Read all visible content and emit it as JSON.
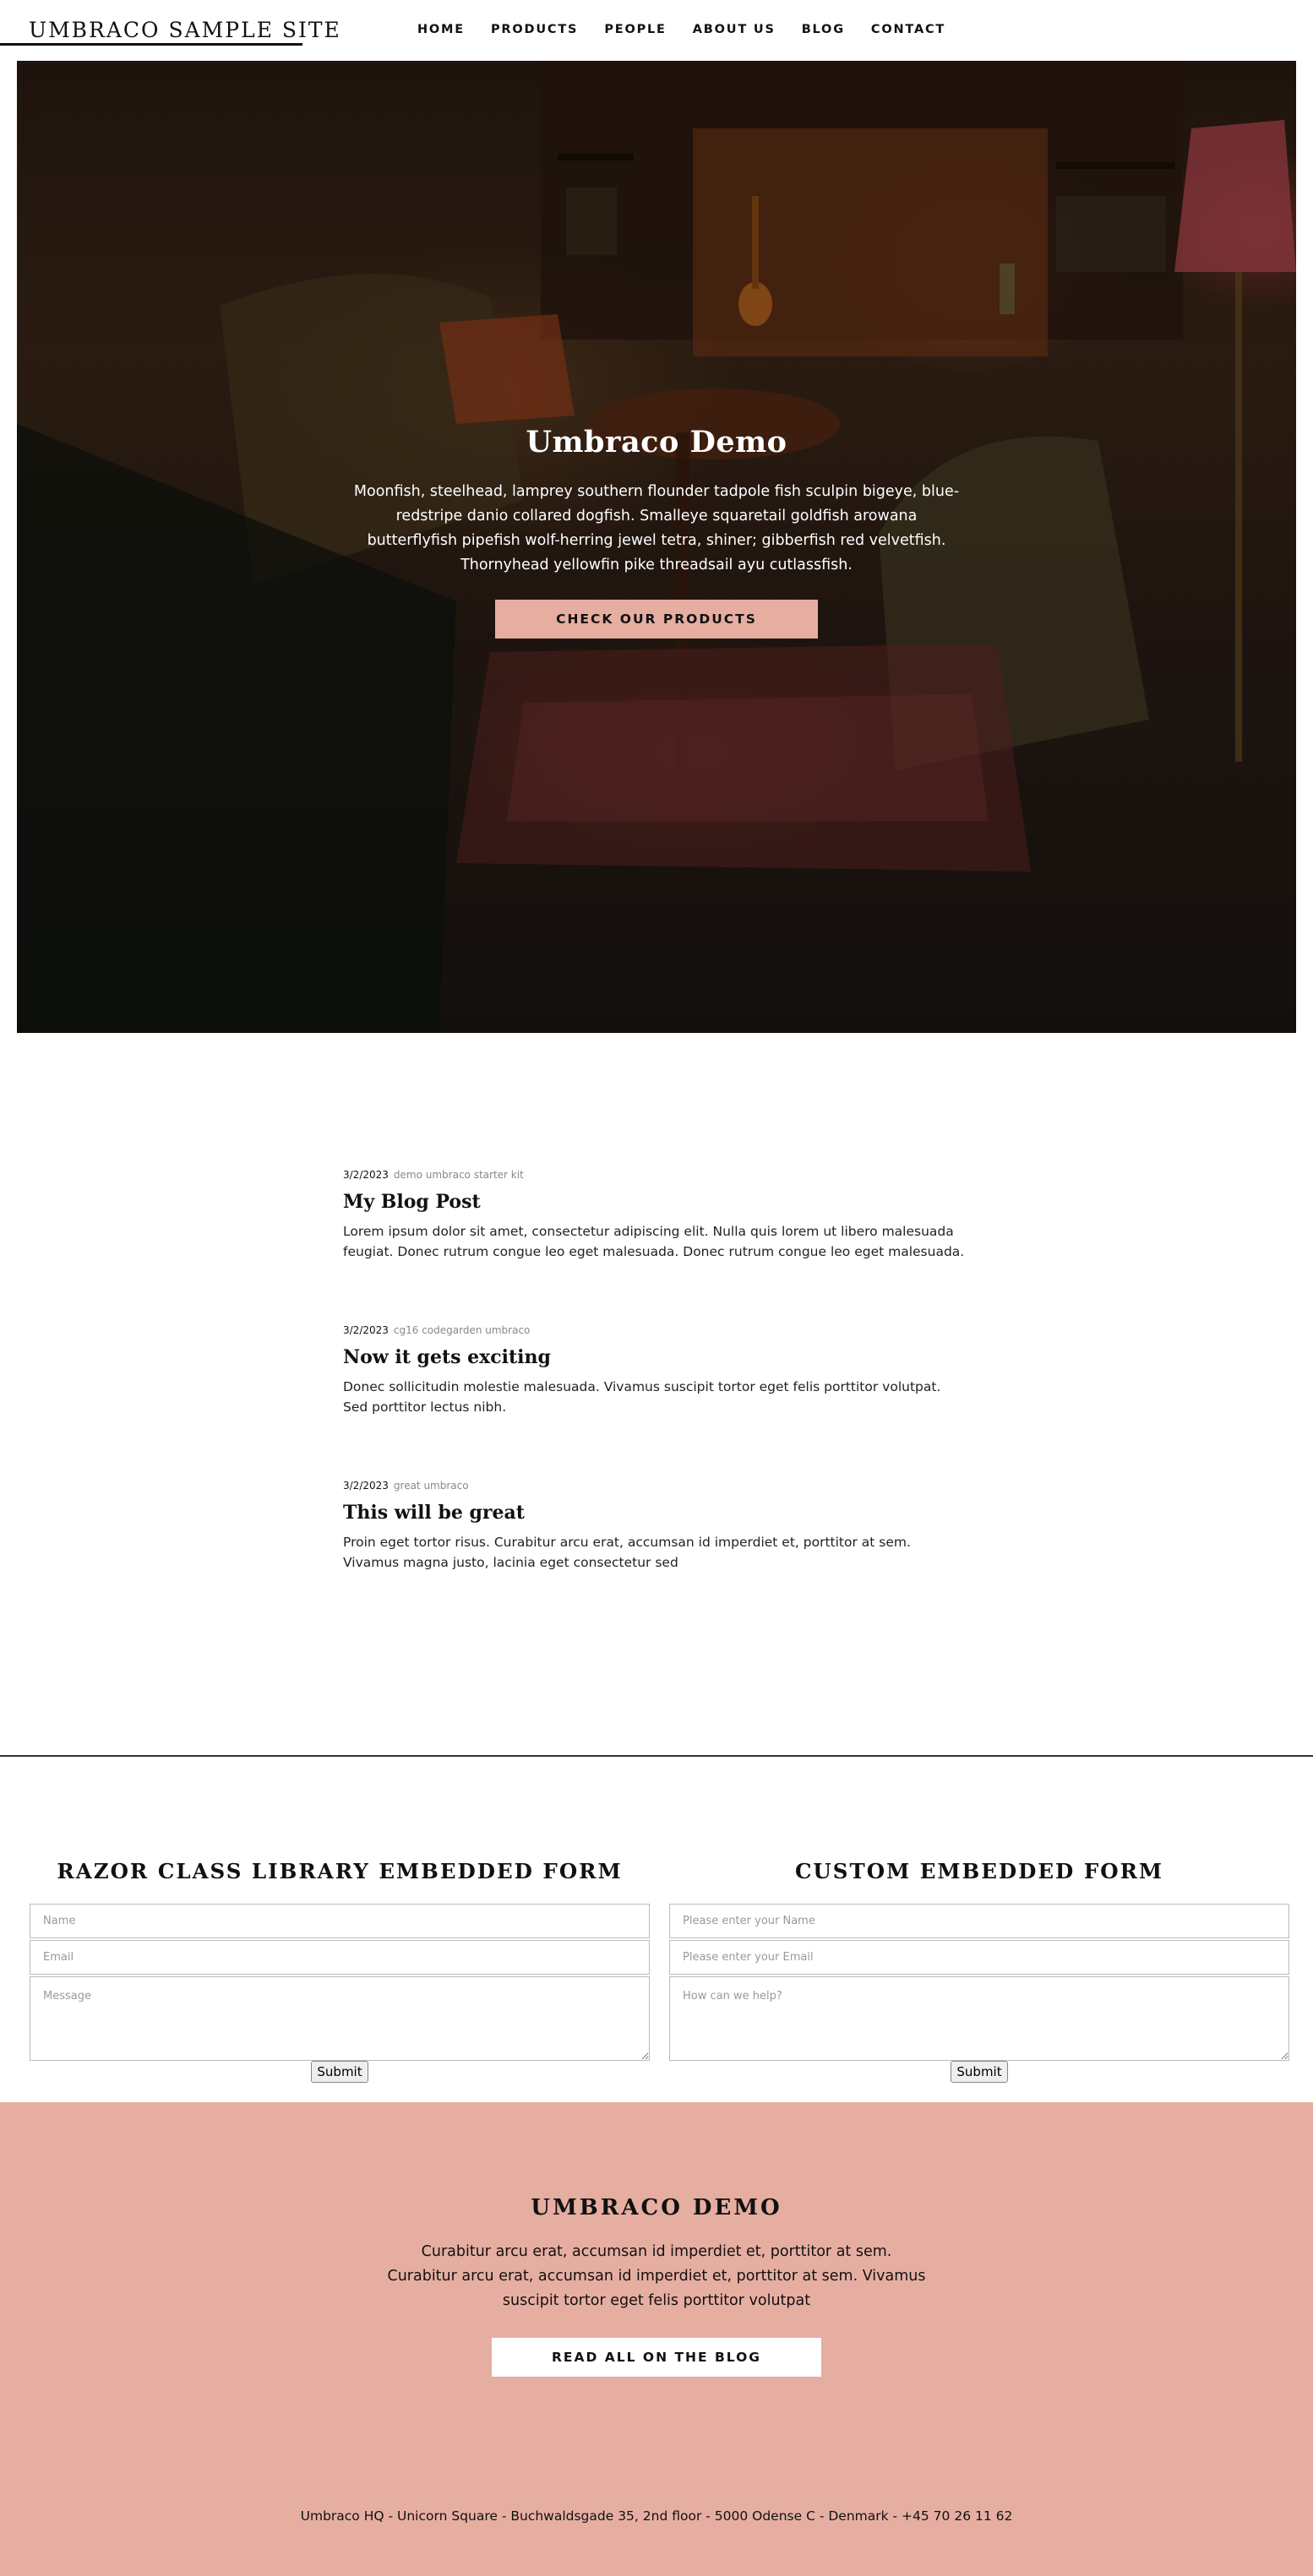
{
  "header": {
    "logo": "UMBRACO SAMPLE SITE",
    "nav": [
      "HOME",
      "PRODUCTS",
      "PEOPLE",
      "ABOUT US",
      "BLOG",
      "CONTACT"
    ]
  },
  "hero": {
    "title": "Umbraco Demo",
    "text": "Moonfish, steelhead, lamprey southern flounder tadpole fish sculpin bigeye, blue-redstripe danio collared dogfish. Smalleye squaretail goldfish arowana butterflyfish pipefish wolf-herring jewel tetra, shiner; gibberfish red velvetfish. Thornyhead yellowfin pike threadsail ayu cutlassfish.",
    "button": "CHECK OUR PRODUCTS"
  },
  "blog": {
    "posts": [
      {
        "date": "3/2/2023",
        "tags": "demo umbraco starter kit",
        "title": "My Blog Post",
        "excerpt": "Lorem ipsum dolor sit amet, consectetur adipiscing elit. Nulla quis lorem ut libero malesuada feugiat. Donec rutrum congue leo eget malesuada. Donec rutrum congue leo eget malesuada."
      },
      {
        "date": "3/2/2023",
        "tags": "cg16 codegarden umbraco",
        "title": "Now it gets exciting",
        "excerpt": "Donec sollicitudin molestie malesuada. Vivamus suscipit tortor eget felis porttitor volutpat. Sed porttitor lectus nibh."
      },
      {
        "date": "3/2/2023",
        "tags": "great umbraco",
        "title": "This will be great",
        "excerpt": "Proin eget tortor risus. Curabitur arcu erat, accumsan id imperdiet et, porttitor at sem. Vivamus magna justo, lacinia eget consectetur sed"
      }
    ]
  },
  "forms": {
    "left": {
      "heading": "RAZOR CLASS LIBRARY EMBEDDED FORM",
      "name_placeholder": "Name",
      "email_placeholder": "Email",
      "message_placeholder": "Message",
      "submit": "Submit"
    },
    "right": {
      "heading": "CUSTOM EMBEDDED FORM",
      "name_placeholder": "Please enter your Name",
      "email_placeholder": "Please enter your Email",
      "message_placeholder": "How can we help?",
      "submit": "Submit"
    }
  },
  "footer": {
    "title": "UMBRACO DEMO",
    "text": "Curabitur arcu erat, accumsan id imperdiet et, porttitor at sem. Curabitur arcu erat, accumsan id imperdiet et, porttitor at sem. Vivamus suscipit tortor eget felis porttitor volutpat",
    "button": "READ ALL ON THE BLOG",
    "address": "Umbraco HQ - Unicorn Square - Buchwaldsgade 35, 2nd floor - 5000 Odense C - Denmark - +45 70 26 11 62"
  },
  "colors": {
    "accent": "#e6aea1",
    "text": "#111111"
  }
}
